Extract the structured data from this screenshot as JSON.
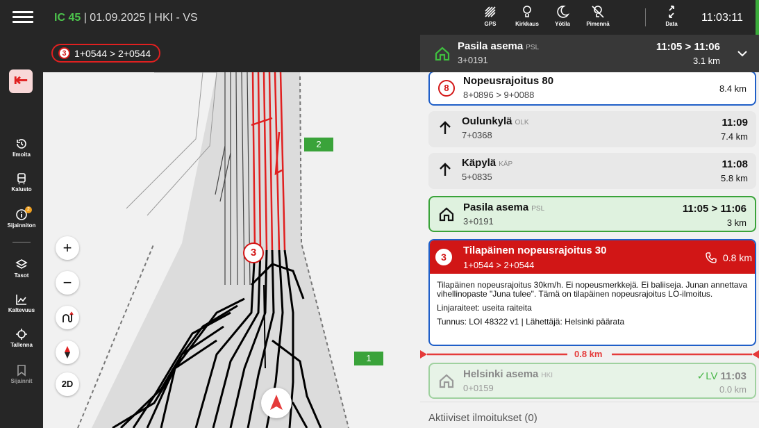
{
  "topbar": {
    "train_id": "IC 45",
    "trip": "| 01.09.2025 | HKI - VS",
    "icons": [
      {
        "name": "gps-icon",
        "label": "GPS"
      },
      {
        "name": "brightness-icon",
        "label": "Kirkkaus"
      },
      {
        "name": "night-mode-icon",
        "label": "Yötila"
      },
      {
        "name": "dim-icon",
        "label": "Pimennä"
      },
      {
        "name": "data-icon",
        "label": "Data"
      }
    ],
    "clock": "11:03:11"
  },
  "rail": {
    "items": [
      {
        "name": "ilmoita",
        "label": "Ilmoita",
        "icon": "history-icon"
      },
      {
        "name": "kalusto",
        "label": "Kalusto",
        "icon": "train-icon"
      },
      {
        "name": "sijainniton",
        "label": "Sijainniton",
        "icon": "info-icon",
        "badge": "2"
      },
      {
        "name": "tasot",
        "label": "Tasot",
        "icon": "layers-icon"
      },
      {
        "name": "kaltevuus",
        "label": "Kaltevuus",
        "icon": "chart-icon"
      },
      {
        "name": "tallenna",
        "label": "Tallenna",
        "icon": "crosshair-icon"
      },
      {
        "name": "sijainnit",
        "label": "Sijainnit",
        "icon": "bookmark-icon"
      }
    ]
  },
  "map": {
    "chip_number": "3",
    "chip_text": "1+0544 > 2+0544",
    "label_2": "2",
    "label_1": "1",
    "marker_number": "3",
    "view_mode": "2D"
  },
  "panel": {
    "header": {
      "name": "Pasila asema",
      "abbr": "PSL",
      "km": "3+0191",
      "time": "11:05 > 11:06",
      "dist": "3.1 km"
    },
    "cards": [
      {
        "type": "speed",
        "number": "8",
        "name": "Nopeusrajoitus 80",
        "abbr": "",
        "km": "8+0896 > 9+0088",
        "time": "",
        "dist": "8.4 km"
      },
      {
        "type": "station",
        "name": "Oulunkylä",
        "abbr": "OLK",
        "km": "7+0368",
        "time": "11:09",
        "dist": "7.4 km"
      },
      {
        "type": "station",
        "name": "Käpylä",
        "abbr": "KÄP",
        "km": "5+0835",
        "time": "11:08",
        "dist": "5.8 km"
      },
      {
        "type": "stop",
        "name": "Pasila asema",
        "abbr": "PSL",
        "km": "3+0191",
        "time": "11:05 > 11:06",
        "dist": "3 km"
      }
    ],
    "warning": {
      "number": "3",
      "title": "Tilapäinen nopeusrajoitus 30",
      "km": "1+0544 > 2+0544",
      "dist": "0.8 km",
      "text1": "Tilapäinen nopeusrajoitus 30km/h. Ei nopeusmerkkejä. Ei baliiseja. Junan annettava vihellinopaste \"Juna tulee\". Tämä on tilapäinen nopeusrajoitus LO-ilmoitus.",
      "text2": "Linjaraiteet: useita raiteita",
      "text3": "Tunnus: LOI 48322 v1 | Lähettäjä: Helsinki päärata"
    },
    "divider_label": "0.8 km",
    "passed": {
      "name": "Helsinki asema",
      "abbr": "HKI",
      "km": "0+0159",
      "status": "✓LV",
      "time": "11:03",
      "dist": "0.0 km"
    },
    "bottom_title": "Aktiiviset ilmoitukset (0)"
  },
  "colors": {
    "accent_red": "#d11616",
    "green": "#3aa33a",
    "blue_border": "#1f5fc8"
  }
}
